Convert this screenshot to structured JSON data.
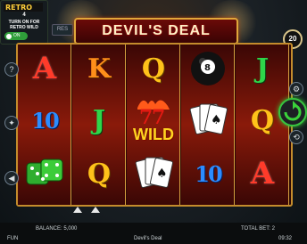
{
  "promo": {
    "count": "4",
    "line1": "TURN ON FOR",
    "line2": "RETRO WILD",
    "toggle": "ON"
  },
  "game": {
    "title": "DEVIL'S DEAL",
    "tag": "RES",
    "bet_level": "20"
  },
  "reels": [
    [
      "A",
      "10",
      "dice"
    ],
    [
      "K",
      "J",
      "Q"
    ],
    [
      "Q",
      "WILD",
      "cards"
    ],
    [
      "8ball",
      "cards",
      "10"
    ],
    [
      "J",
      "Q",
      "A"
    ]
  ],
  "wild_label": "WILD",
  "eight_ball_label": "8",
  "status": {
    "balance_label": "BALANCE:",
    "balance_value": "5,000",
    "mode": "FUN",
    "game_name": "Devil's Deal",
    "total_bet_label": "TOTAL BET:",
    "total_bet_value": "2",
    "time": "09:32"
  },
  "colors": {
    "accent_gold": "#e0a73a",
    "spin_green": "#37c43f",
    "reel_red": "#8a1a0a"
  }
}
